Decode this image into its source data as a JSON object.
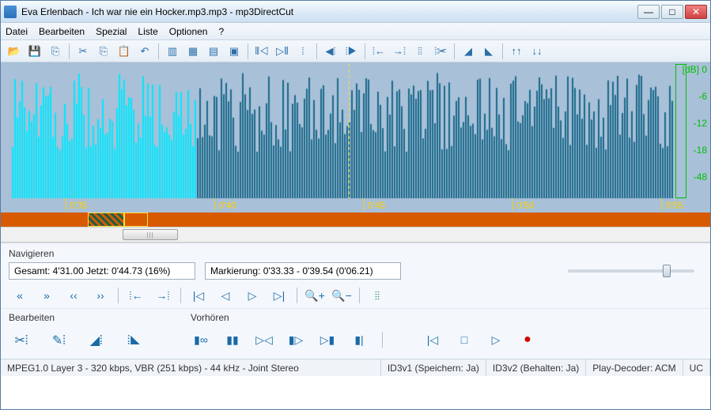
{
  "window": {
    "title": "Eva Erlenbach - Ich war nie ein Hocker.mp3.mp3 - mp3DirectCut"
  },
  "menu": {
    "items": [
      "Datei",
      "Bearbeiten",
      "Spezial",
      "Liste",
      "Optionen",
      "?"
    ]
  },
  "toolbar": {
    "groups": [
      [
        "open-icon",
        "save-icon",
        "save-sel-icon"
      ],
      [
        "cut-icon",
        "copy-icon",
        "paste-icon",
        "undo-icon"
      ],
      [
        "zoom-in-icon",
        "zoom-sel-icon",
        "zoom-out-icon",
        "zoom-full-icon"
      ],
      [
        "set-begin-icon",
        "set-end-icon",
        "cue-icon"
      ],
      [
        "nudge-left-icon",
        "nudge-right-icon"
      ],
      [
        "trim-left-icon",
        "trim-right-icon",
        "crop-icon",
        "split-icon"
      ],
      [
        "fade-in-icon",
        "fade-out-icon"
      ],
      [
        "gain-up-icon",
        "gain-down-icon"
      ]
    ]
  },
  "waveform": {
    "db_labels": [
      "[dB]  0",
      "-6",
      "-12",
      "-18",
      "-48"
    ],
    "time_labels": [
      {
        "pos_pct": 9,
        "text": "0'35"
      },
      {
        "pos_pct": 30,
        "text": "0'40"
      },
      {
        "pos_pct": 51,
        "text": "0'45"
      },
      {
        "pos_pct": 72,
        "text": "0'50"
      },
      {
        "pos_pct": 93,
        "text": "0'55"
      }
    ],
    "selection_end_pct": 27.5,
    "cursor_pct": 49
  },
  "navigate": {
    "label": "Navigieren",
    "total_field": "Gesamt: 4'31.00   Jetzt: 0'44.73   (16%)",
    "sel_field": "Markierung: 0'33.33 - 0'39.54 (0'06.21)"
  },
  "nav_buttons": [
    "«",
    "»",
    "‹‹",
    "››",
    "⦙←",
    "→⦙",
    "|◁",
    "◁",
    "▷",
    "▷|",
    "🔍+",
    "🔍−",
    "⦙⦙"
  ],
  "edit": {
    "label": "Bearbeiten"
  },
  "preview": {
    "label": "Vorhören"
  },
  "status": {
    "format": "MPEG1.0 Layer 3 - 320 kbps, VBR (251 kbps) - 44 kHz - Joint Stereo",
    "id3v1": "ID3v1 (Speichern: Ja)",
    "id3v2": "ID3v2 (Behalten: Ja)",
    "decoder": "Play-Decoder: ACM",
    "uc": "UC"
  }
}
